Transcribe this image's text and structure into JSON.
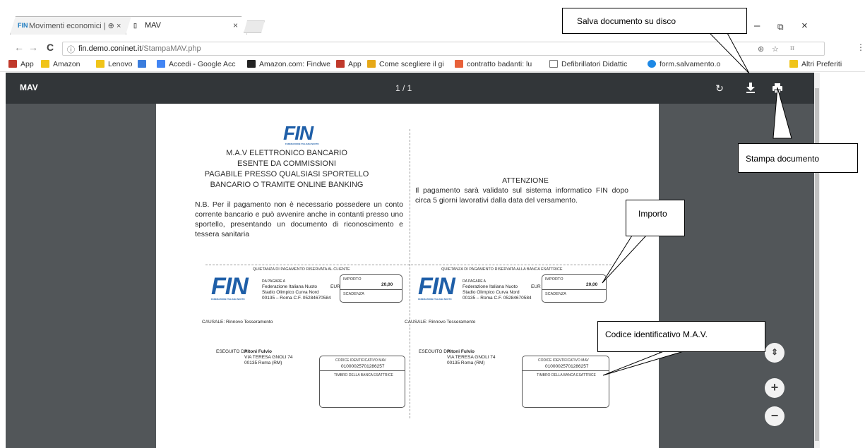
{
  "browser": {
    "tabs": [
      {
        "favicon": "FIN",
        "title": "Movimenti economici | ⊕ ×"
      },
      {
        "favicon": "doc-icon",
        "title": "MAV"
      }
    ],
    "close_glyph": "×",
    "window_controls": {
      "minimize": "–",
      "restore": "⧉",
      "close": "×"
    },
    "nav": {
      "back": "←",
      "forward": "→",
      "reload": "C"
    },
    "url_host": "fin.demo.coninet.it",
    "url_path": "/StampaMAV.php",
    "bookmarks": [
      {
        "label": "App",
        "color": "#c0392b"
      },
      {
        "label": "Amazon",
        "color": "#f0c419"
      },
      {
        "label": "Lenovo",
        "color": "#f0c419"
      },
      {
        "label": "",
        "color": "#3b7ddd"
      },
      {
        "label": "Accedi - Google Acc",
        "color": "#4285f4"
      },
      {
        "label": "Amazon.com: Findwe",
        "color": "#222222"
      },
      {
        "label": "App",
        "color": "#c0392b"
      },
      {
        "label": "Come scegliere il gi",
        "color": "#e6a817"
      },
      {
        "label": "contratto badanti: lu",
        "color": "#e8613a"
      },
      {
        "label": "Defibrillatori Didattic",
        "color": "#777777"
      },
      {
        "label": "form.salvamento.o",
        "color": "#1e88e5"
      },
      {
        "label": "»",
        "color": ""
      },
      {
        "label": "Altri Preferiti",
        "color": "#f0c419"
      }
    ]
  },
  "pdf_viewer": {
    "title": "MAV",
    "page_indicator": "1 / 1",
    "rotate_icon": "rotate-icon",
    "download_icon": "download-icon",
    "print_icon": "print-icon",
    "zoom_fit": "⇕",
    "zoom_in": "+",
    "zoom_out": "−"
  },
  "document": {
    "logo_text": "FIN",
    "logo_sub": "FEDERAZIONE ITALIANA NUOTO",
    "heading_lines": [
      "M.A.V ELETTRONICO BANCARIO",
      "ESENTE DA COMMISSIONI",
      "PAGABILE PRESSO QUALSIASI SPORTELLO",
      "BANCARIO O TRAMITE ONLINE BANKING"
    ],
    "nb_text": "N.B. Per il pagamento non è necessario possedere un conto corrente bancario e può avvenire anche in contanti presso uno sportello, presentando un documento di riconoscimento e tessera sanitaria",
    "attention_title": "ATTENZIONE",
    "attention_text": "Il pagamento sarà validato sul sistema informatico FIN dopo circa 5 giorni lavorativi dalla data del versamento.",
    "left_receipt_title": "QUIETANZA DI PAGAMENTO RISERVATA AL CLIENTE",
    "right_receipt_title": "QUIETANZA DI PAGAMENTO RISERVATA ALLA BANCA ESATTRICE",
    "payee_label": "DA PAGARE A",
    "payee_lines": [
      "Federazione Italiana Nuoto",
      "Stadio Olimpico Curva Nord",
      "00135 – Roma C.F. 05284670584"
    ],
    "eur_label": "EUR",
    "importo_label": "IMPORTO",
    "importo_value": "20,00",
    "scadenza_label": "SCADENZA",
    "causale_label": "CAUSALE:",
    "causale_value": "Rinnovo Tesseramento",
    "eseguito_label": "ESEGUITO DA:",
    "eseguito_left": [
      "Pitoni Fulvio",
      "VIA TERESA GNOLI 74",
      "00135 Roma (RM)"
    ],
    "eseguito_right": [
      "Pitoni Fulvio",
      "VIA TERESA GNOLI 74",
      "00135 Roma (RM)"
    ],
    "codice_label": "CODICE IDENTIFICATIVO MAV",
    "codice_value": "01000025701286257",
    "timbro_label": "TIMBRO DELLA BANCA ESATTRICE"
  },
  "callouts": {
    "salva": "Salva documento su disco",
    "stampa": "Stampa documento",
    "importo": "Importo",
    "codice": "Codice identificativo M.A.V."
  }
}
